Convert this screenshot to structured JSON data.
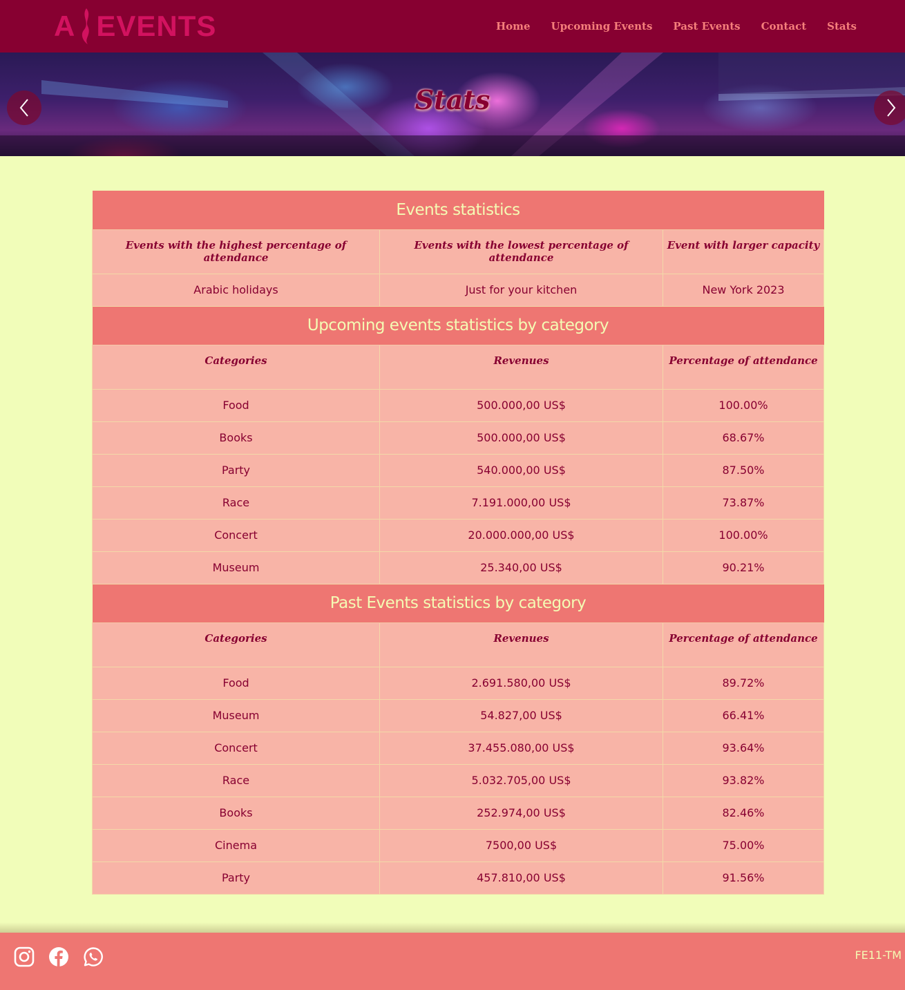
{
  "header": {
    "logo_text": "AEVENTS",
    "logo_letter_a": "A",
    "logo_letters_rest": "EVENTS",
    "nav": [
      "Home",
      "Upcoming Events",
      "Past Events",
      "Contact",
      "Stats"
    ]
  },
  "banner": {
    "title": "Stats",
    "prev_icon": "chevron-left-icon",
    "next_icon": "chevron-right-icon"
  },
  "stats": {
    "events_section_title": "Events statistics",
    "events_headers": [
      "Events with the highest percentage of attendance",
      "Events with the lowest percentage of attendance",
      "Event with larger capacity"
    ],
    "events_values": [
      "Arabic holidays",
      "Just for your kitchen",
      "New York 2023"
    ],
    "upcoming_section_title": "Upcoming events statistics by category",
    "past_section_title": "Past Events statistics by category",
    "category_headers": [
      "Categories",
      "Revenues",
      "Percentage of attendance"
    ],
    "upcoming_rows": [
      [
        "Food",
        "500.000,00 US$",
        "100.00%"
      ],
      [
        "Books",
        "500.000,00 US$",
        "68.67%"
      ],
      [
        "Party",
        "540.000,00 US$",
        "87.50%"
      ],
      [
        "Race",
        "7.191.000,00 US$",
        "73.87%"
      ],
      [
        "Concert",
        "20.000.000,00 US$",
        "100.00%"
      ],
      [
        "Museum",
        "25.340,00 US$",
        "90.21%"
      ]
    ],
    "past_rows": [
      [
        "Food",
        "2.691.580,00 US$",
        "89.72%"
      ],
      [
        "Museum",
        "54.827,00 US$",
        "66.41%"
      ],
      [
        "Concert",
        "37.455.080,00 US$",
        "93.64%"
      ],
      [
        "Race",
        "5.032.705,00 US$",
        "93.82%"
      ],
      [
        "Books",
        "252.974,00 US$",
        "82.46%"
      ],
      [
        "Cinema",
        "7500,00 US$",
        "75.00%"
      ],
      [
        "Party",
        "457.810,00 US$",
        "91.56%"
      ]
    ]
  },
  "footer": {
    "social_icons": [
      "instagram-icon",
      "facebook-icon",
      "whatsapp-icon"
    ],
    "credit": "FE11-TM"
  },
  "colors": {
    "header_bg": "#870031",
    "nav_text": "#f57f7b",
    "logo": "#d2125f",
    "page_bg": "#f1fdb9",
    "section_bg": "#ee7672",
    "section_text": "#f4fbb4",
    "cell_bg": "#f8b4a7",
    "cell_text": "#870031"
  }
}
